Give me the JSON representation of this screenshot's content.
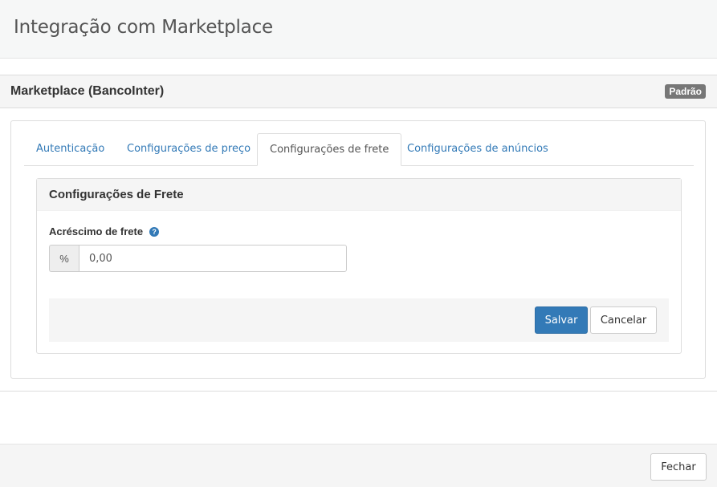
{
  "modal": {
    "title": "Integração com Marketplace"
  },
  "section": {
    "title": "Marketplace (BancoInter)",
    "badge": "Padrão"
  },
  "tabs": [
    {
      "label": "Autenticação",
      "active": false
    },
    {
      "label": "Configurações de preço",
      "active": false
    },
    {
      "label": "Configurações de frete",
      "active": true
    },
    {
      "label": "Configurações de anúncios",
      "active": false
    }
  ],
  "panel": {
    "title": "Configurações de Frete",
    "field_label": "Acréscimo de frete",
    "help_icon": "question-circle-icon",
    "addon": "%",
    "value": "0,00"
  },
  "buttons": {
    "save": "Salvar",
    "cancel": "Cancelar",
    "close": "Fechar"
  },
  "colors": {
    "primary": "#337ab7",
    "badge": "#777777",
    "link": "#337ab7"
  }
}
